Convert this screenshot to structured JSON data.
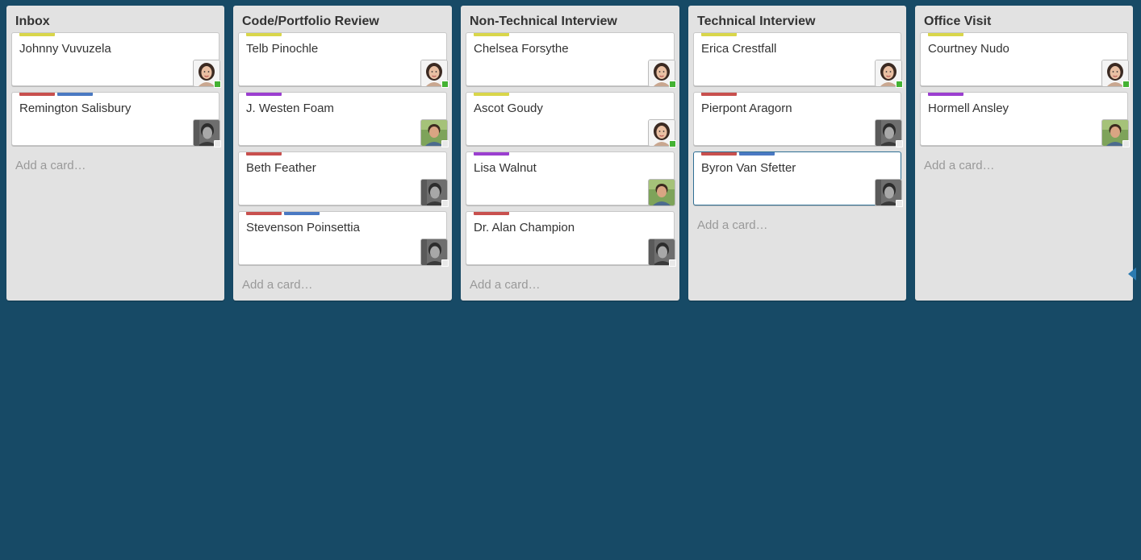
{
  "colors": {
    "background": "#174a66",
    "label_yellow": "#d9d64a",
    "label_red": "#c8504e",
    "label_blue": "#4a79c2",
    "label_purple": "#9b3fd0",
    "status_green": "#44b233",
    "status_gray": "#e8e8e8"
  },
  "lists": [
    {
      "title": "Inbox",
      "add_card": "Add a card…",
      "cards": [
        {
          "title": "Johnny Vuvuzela",
          "labels": [
            "yellow"
          ],
          "avatar": "avatar-woman-icon",
          "status": "green"
        },
        {
          "title": "Remington Salisbury",
          "labels": [
            "red",
            "blue"
          ],
          "avatar": "avatar-man-bw-icon",
          "status": "gray"
        }
      ]
    },
    {
      "title": "Code/Portfolio Review",
      "add_card": "Add a card…",
      "cards": [
        {
          "title": "Telb Pinochle",
          "labels": [
            "yellow"
          ],
          "avatar": "avatar-woman-icon",
          "status": "green"
        },
        {
          "title": "J. Westen Foam",
          "labels": [
            "purple"
          ],
          "avatar": "avatar-man-color-icon",
          "status": "gray"
        },
        {
          "title": "Beth Feather",
          "labels": [
            "red"
          ],
          "avatar": "avatar-man-bw-icon",
          "status": "gray"
        },
        {
          "title": "Stevenson Poinsettia",
          "labels": [
            "red",
            "blue"
          ],
          "avatar": "avatar-man-bw-icon",
          "status": "gray"
        }
      ]
    },
    {
      "title": "Non-Technical Interview",
      "add_card": "Add a card…",
      "cards": [
        {
          "title": "Chelsea Forsythe",
          "labels": [
            "yellow"
          ],
          "avatar": "avatar-woman-icon",
          "status": "green"
        },
        {
          "title": "Ascot Goudy",
          "labels": [
            "yellow"
          ],
          "avatar": "avatar-woman-icon",
          "status": "green"
        },
        {
          "title": "Lisa Walnut",
          "labels": [
            "purple"
          ],
          "avatar": "avatar-man-color-icon",
          "status": "none"
        },
        {
          "title": "Dr. Alan Champion",
          "labels": [
            "red"
          ],
          "avatar": "avatar-man-bw-icon",
          "status": "gray"
        }
      ]
    },
    {
      "title": "Technical Interview",
      "add_card": "Add a card…",
      "cards": [
        {
          "title": "Erica Crestfall",
          "labels": [
            "yellow"
          ],
          "avatar": "avatar-woman-icon",
          "status": "green"
        },
        {
          "title": "Pierpont Aragorn",
          "labels": [
            "red"
          ],
          "avatar": "avatar-man-bw-icon",
          "status": "gray"
        },
        {
          "title": "Byron Van Sfetter",
          "labels": [
            "red",
            "blue"
          ],
          "avatar": "avatar-man-bw-icon",
          "status": "gray",
          "active": true
        }
      ]
    },
    {
      "title": "Office Visit",
      "add_card": "Add a card…",
      "cards": [
        {
          "title": "Courtney Nudo",
          "labels": [
            "yellow"
          ],
          "avatar": "avatar-woman-icon",
          "status": "green"
        },
        {
          "title": "Hormell Ansley",
          "labels": [
            "purple"
          ],
          "avatar": "avatar-man-color-icon",
          "status": "gray"
        }
      ]
    }
  ]
}
